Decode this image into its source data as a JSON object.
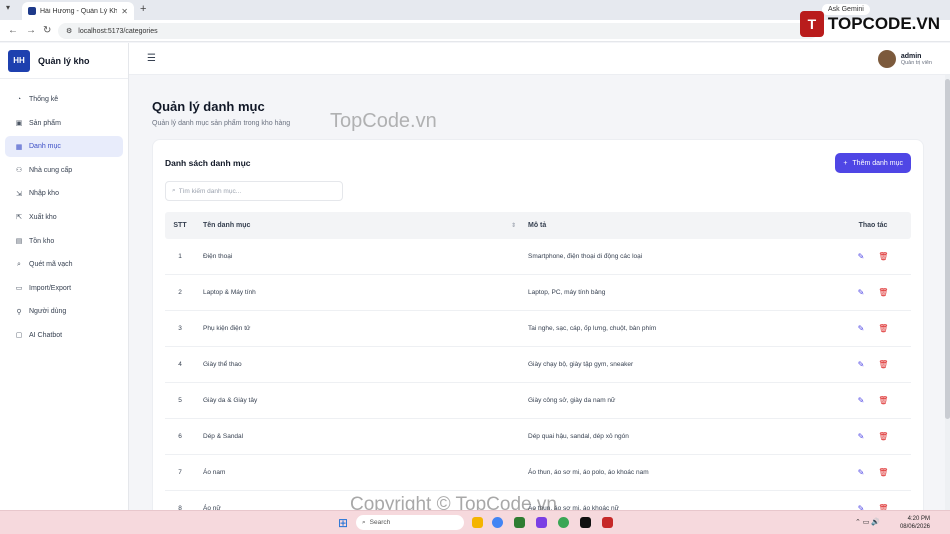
{
  "browser": {
    "tab_title": "Hải Hương - Quản Lý Kho",
    "url": "localhost:5173/categories",
    "ask_gemini": "Ask Gemini"
  },
  "brand_badge": {
    "text": "TOPCODE.VN",
    "letter": "T"
  },
  "sidebar": {
    "logo_text": "HH",
    "title": "Quản lý kho",
    "items": [
      {
        "label": "Thống kê",
        "icon": "chart-icon",
        "glyph": "◔"
      },
      {
        "label": "Sản phẩm",
        "icon": "box-icon",
        "glyph": "▣"
      },
      {
        "label": "Danh mục",
        "icon": "grid-icon",
        "glyph": "▦"
      },
      {
        "label": "Nhà cung cấp",
        "icon": "users-icon",
        "glyph": "⚇"
      },
      {
        "label": "Nhập kho",
        "icon": "import-icon",
        "glyph": "⇲"
      },
      {
        "label": "Xuất kho",
        "icon": "export-icon",
        "glyph": "⇱"
      },
      {
        "label": "Tồn kho",
        "icon": "inventory-icon",
        "glyph": "▤"
      },
      {
        "label": "Quét mã vạch",
        "icon": "scan-icon",
        "glyph": "⌕"
      },
      {
        "label": "Import/Export",
        "icon": "file-icon",
        "glyph": "▭"
      },
      {
        "label": "Người dùng",
        "icon": "user-icon",
        "glyph": "⚲"
      },
      {
        "label": "AI Chatbot",
        "icon": "bot-icon",
        "glyph": "▢"
      }
    ],
    "active_index": 2
  },
  "header": {
    "user_name": "admin",
    "user_role": "Quản trị viên"
  },
  "page": {
    "title": "Quản lý danh mục",
    "subtitle": "Quản lý danh mục sản phẩm trong kho hàng"
  },
  "card": {
    "title": "Danh sách danh mục",
    "add_button": "Thêm danh mục",
    "search_placeholder": "Tìm kiếm danh mục..."
  },
  "table": {
    "columns": [
      "STT",
      "Tên danh mục",
      "Mô tả",
      "Thao tác"
    ],
    "rows": [
      {
        "stt": "1",
        "name": "Điện thoại",
        "desc": "Smartphone, điện thoại di động các loại"
      },
      {
        "stt": "2",
        "name": "Laptop & Máy tính",
        "desc": "Laptop, PC, máy tính bảng"
      },
      {
        "stt": "3",
        "name": "Phụ kiện điện tử",
        "desc": "Tai nghe, sạc, cáp, ốp lưng, chuột, bàn phím"
      },
      {
        "stt": "4",
        "name": "Giày thể thao",
        "desc": "Giày chạy bộ, giày tập gym, sneaker"
      },
      {
        "stt": "5",
        "name": "Giày da & Giày tây",
        "desc": "Giày công sở, giày da nam nữ"
      },
      {
        "stt": "6",
        "name": "Dép & Sandal",
        "desc": "Dép quai hậu, sandal, dép xỏ ngón"
      },
      {
        "stt": "7",
        "name": "Áo nam",
        "desc": "Áo thun, áo sơ mi, áo polo, áo khoác nam"
      },
      {
        "stt": "8",
        "name": "Áo nữ",
        "desc": "Áo thun, áo sơ mi, áo khoác nữ"
      }
    ]
  },
  "watermarks": {
    "center": "TopCode.vn",
    "bottom": "Copyright © TopCode.vn"
  },
  "taskbar": {
    "search": "Search",
    "time": "4:20 PM",
    "date": "08/06/2026"
  },
  "colors": {
    "accent": "#4f46e5",
    "danger": "#dc2626",
    "active_bg": "#e8ecfb"
  }
}
